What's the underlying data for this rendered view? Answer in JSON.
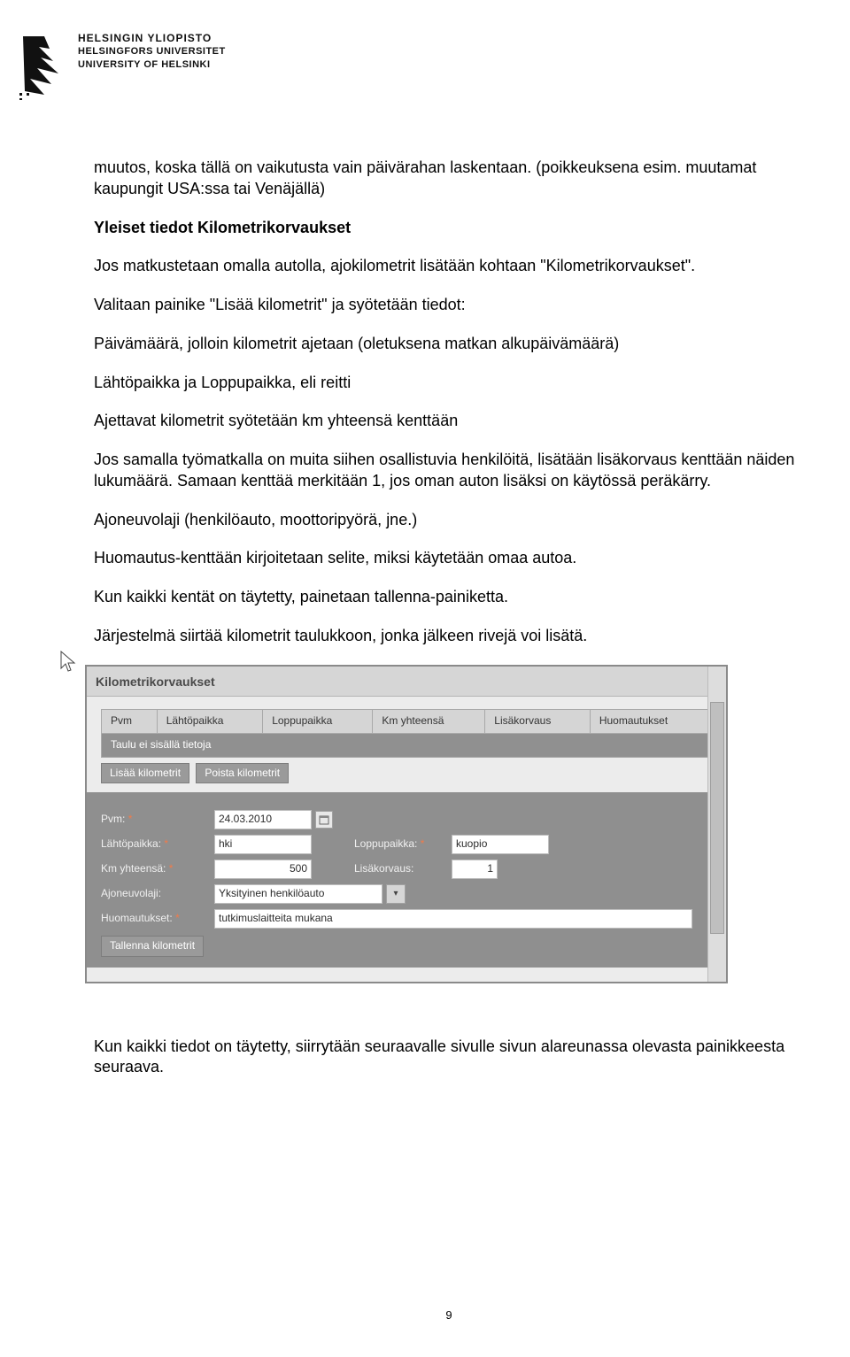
{
  "logo": {
    "line1": "HELSINGIN YLIOPISTO",
    "line2": "HELSINGFORS UNIVERSITET",
    "line3": "UNIVERSITY OF HELSINKI"
  },
  "para1": "muutos, koska tällä on vaikutusta vain päivärahan laskentaan. (poikkeuksena esim. muutamat kaupungit USA:ssa tai Venäjällä)",
  "heading": "Yleiset tiedot Kilometrikorvaukset",
  "para2": "Jos matkustetaan omalla autolla, ajokilometrit lisätään kohtaan \"Kilometrikorvaukset\".",
  "para3a": "Valitaan painike \"Lisää kilometrit\" ja syötetään tiedot:",
  "para3b": "Päivämäärä, jolloin kilometrit ajetaan (oletuksena matkan alkupäivämäärä)",
  "para3c": "Lähtöpaikka ja Loppupaikka, eli reitti",
  "para3d": "Ajettavat kilometrit syötetään km yhteensä kenttään",
  "para3e": "Jos samalla työmatkalla on muita siihen osallistuvia henkilöitä, lisätään lisäkorvaus kenttään näiden lukumäärä. Samaan kenttää merkitään 1, jos oman auton lisäksi on käytössä peräkärry.",
  "para3f": "Ajoneuvolaji (henkilöauto, moottoripyörä, jne.)",
  "para3g": "Huomautus-kenttään kirjoitetaan selite, miksi käytetään omaa autoa.",
  "para3h": "Kun kaikki kentät on täytetty, painetaan tallenna-painiketta.",
  "para3i": "Järjestelmä siirtää kilometrit taulukkoon, jonka jälkeen rivejä voi lisätä.",
  "para4": "Kun  kaikki tiedot on täytetty, siirrytään seuraavalle sivulle sivun alareunassa olevasta painikkeesta seuraava.",
  "ui": {
    "title": "Kilometrikorvaukset",
    "columns": [
      "Pvm",
      "Lähtöpaikka",
      "Loppupaikka",
      "Km yhteensä",
      "Lisäkorvaus",
      "Huomautukset"
    ],
    "emptyRow": "Taulu ei sisällä tietoja",
    "btn_add": "Lisää kilometrit",
    "btn_del": "Poista kilometrit",
    "lbl_pvm": "Pvm:",
    "val_pvm": "24.03.2010",
    "lbl_lahto": "Lähtöpaikka:",
    "val_lahto": "hki",
    "lbl_loppu": "Loppupaikka:",
    "val_loppu": "kuopio",
    "lbl_km": "Km yhteensä:",
    "val_km": "500",
    "lbl_lis": "Lisäkorvaus:",
    "val_lis": "1",
    "lbl_ajo": "Ajoneuvolaji:",
    "val_ajo": "Yksityinen henkilöauto",
    "lbl_huom": "Huomautukset:",
    "val_huom": "tutkimuslaitteita mukana",
    "btn_save": "Tallenna kilometrit",
    "star": "*"
  },
  "pageNumber": "9"
}
